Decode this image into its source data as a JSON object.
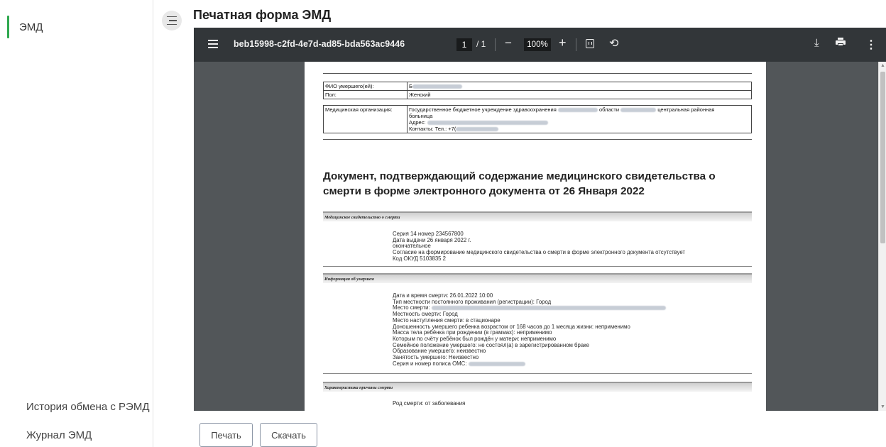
{
  "sidebar": {
    "active_item": "ЭМД",
    "bottom_items": [
      "История обмена с РЭМД",
      "Журнал ЭМД"
    ],
    "accent_color": "#2fa84f"
  },
  "header": {
    "title": "Печатная форма ЭМД"
  },
  "viewer": {
    "file_name": "beb15998-c2fd-4e7d-ad85-bda563ac9446",
    "current_page": "1",
    "page_count": "/ 1",
    "zoom": "100%",
    "icons": [
      "menu-icon",
      "zoom-out-icon",
      "zoom-in-icon",
      "fit-page-icon",
      "rotate-icon",
      "download-icon",
      "print-icon",
      "more-icon"
    ]
  },
  "document": {
    "patient_table": [
      {
        "key": "ФИО умершего(ей):",
        "value": "Б"
      },
      {
        "key": "Пол:",
        "value": "Женский"
      }
    ],
    "org_table": {
      "key": "Медицинская организация:",
      "line1_a": "Государственное бюджетное учреждение здравоохранения",
      "line1_b": "области",
      "line1_c": "центральная районная",
      "line2": "больница",
      "line3": "Адрес:",
      "line4": "Контакты: Тел.: +7("
    },
    "heading": "Документ, подтверждающий содержание медицинского свидетельства о смерти в форме электронного документа от 26 Января 2022",
    "sections": [
      {
        "title": "Медицинское свидетельство о смерти",
        "lines": [
          "Серия 14 номер 234567800",
          "Дата выдачи 26 января 2022 г.",
          "окончательное",
          "Согласие на формирование медицинского свидетельства о смерти в форме электронного документа отсутствует",
          "Код ОКУД 5103835 2"
        ]
      },
      {
        "title": "Информация об умершем",
        "lines": [
          "Дата и время смерти: 26.01.2022 10:00",
          "Тип местности постоянного проживания (регистрации): Город",
          "Место смерти:",
          "Местность смерти: Город",
          "Место наступления смерти: в стационаре",
          "Доношенность умершего ребенка возрастом от 168 часов до 1 месяца жизни: неприменимо",
          "Масса тела ребёнка при рождении (в граммах): неприменимо",
          "Которым по счёту ребёнок был рождён у матери: неприменимо",
          "Семейное положение умершего: не состоял(а) в зарегистрированном браке",
          "Образование умершего: неизвестно",
          "Занятость умершего: Неизвестно",
          "Серия и номер полиса ОМС:"
        ]
      },
      {
        "title": "Характеристика причины смерти",
        "lines": [
          "Род смерти: от заболевания"
        ]
      }
    ]
  },
  "actions": {
    "print_label": "Печать",
    "download_label": "Скачать"
  }
}
